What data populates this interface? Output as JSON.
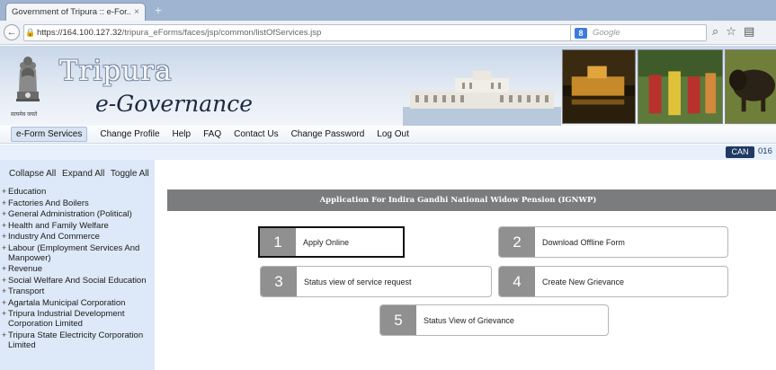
{
  "browser": {
    "tab_title": "Government of Tripura :: e-For...",
    "tab_close": "×",
    "new_tab": "+",
    "url_host": "https://164.100.127.32",
    "url_path": "/tripura_eForms/faces/jsp/common/listOfServices.jsp",
    "url_controls": "▽ C",
    "search_engine": "8",
    "search_placeholder": "Google",
    "back_glyph": "←",
    "lock_glyph": "🔒",
    "nav_icon_glyphs": [
      "⌕",
      "☆",
      "▤"
    ]
  },
  "banner": {
    "title": "Tripura",
    "subtitle": "e-Governance",
    "emblem_caption": "सत्यमेव जयते"
  },
  "menu": {
    "items": [
      "e-Form Services",
      "Change Profile",
      "Help",
      "FAQ",
      "Contact Us",
      "Change Password",
      "Log Out"
    ]
  },
  "status": {
    "can_label": "CAN",
    "can_number": "016"
  },
  "sidebar": {
    "tools": [
      "Collapse All",
      "Expand All",
      "Toggle All"
    ],
    "items": [
      "Education",
      "Factories And Boilers",
      "General Administration (Political)",
      "Health and Family Welfare",
      "Industry And Commerce",
      "Labour (Employment Services And Manpower)",
      "Revenue",
      "Social Welfare And Social Education",
      "Transport",
      "Agartala Municipal Corporation",
      "Tripura Industrial Development Corporation Limited",
      "Tripura State Electricity Corporation Limited"
    ],
    "expand_glyph": "+"
  },
  "main": {
    "page_title": "Application For Indira Gandhi National Widow Pension (IGNWP)",
    "options": [
      {
        "num": "1",
        "label": "Apply Online"
      },
      {
        "num": "2",
        "label": "Download Offline Form"
      },
      {
        "num": "3",
        "label": "Status view of service request"
      },
      {
        "num": "4",
        "label": "Create New Grievance"
      },
      {
        "num": "5",
        "label": "Status View of Grievance"
      }
    ]
  },
  "colors": {
    "title_bar": "#7b7c7e",
    "option_number_bg": "#909090",
    "sidebar_bg": "#dde9f8",
    "can_badge": "#203a64"
  }
}
